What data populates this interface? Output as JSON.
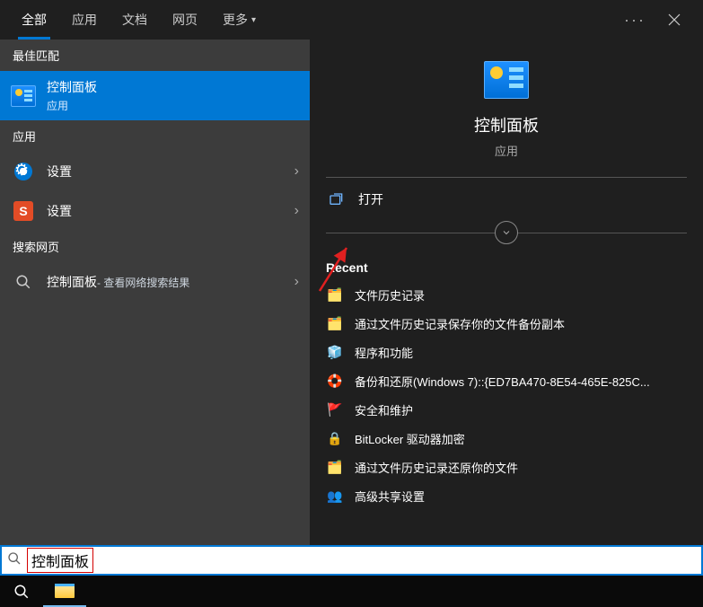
{
  "tabs": {
    "all": "全部",
    "apps": "应用",
    "docs": "文档",
    "web": "网页",
    "more": "更多"
  },
  "sections": {
    "best_match": "最佳匹配",
    "apps": "应用",
    "search_web": "搜索网页"
  },
  "best_match": {
    "title": "控制面板",
    "sub": "应用"
  },
  "app_items": [
    {
      "title": "设置",
      "icon": "gear"
    },
    {
      "title": "设置",
      "icon": "s"
    }
  ],
  "web_item": {
    "title": "控制面板",
    "sub": " - 查看网络搜索结果"
  },
  "detail": {
    "name": "控制面板",
    "kind": "应用",
    "open": "打开",
    "recent_header": "Recent",
    "recent": [
      "文件历史记录",
      "通过文件历史记录保存你的文件备份副本",
      "程序和功能",
      "备份和还原(Windows 7)::{ED7BA470-8E54-465E-825C...",
      "安全和维护",
      "BitLocker 驱动器加密",
      "通过文件历史记录还原你的文件",
      "高级共享设置"
    ]
  },
  "search": {
    "value": "控制面板"
  }
}
